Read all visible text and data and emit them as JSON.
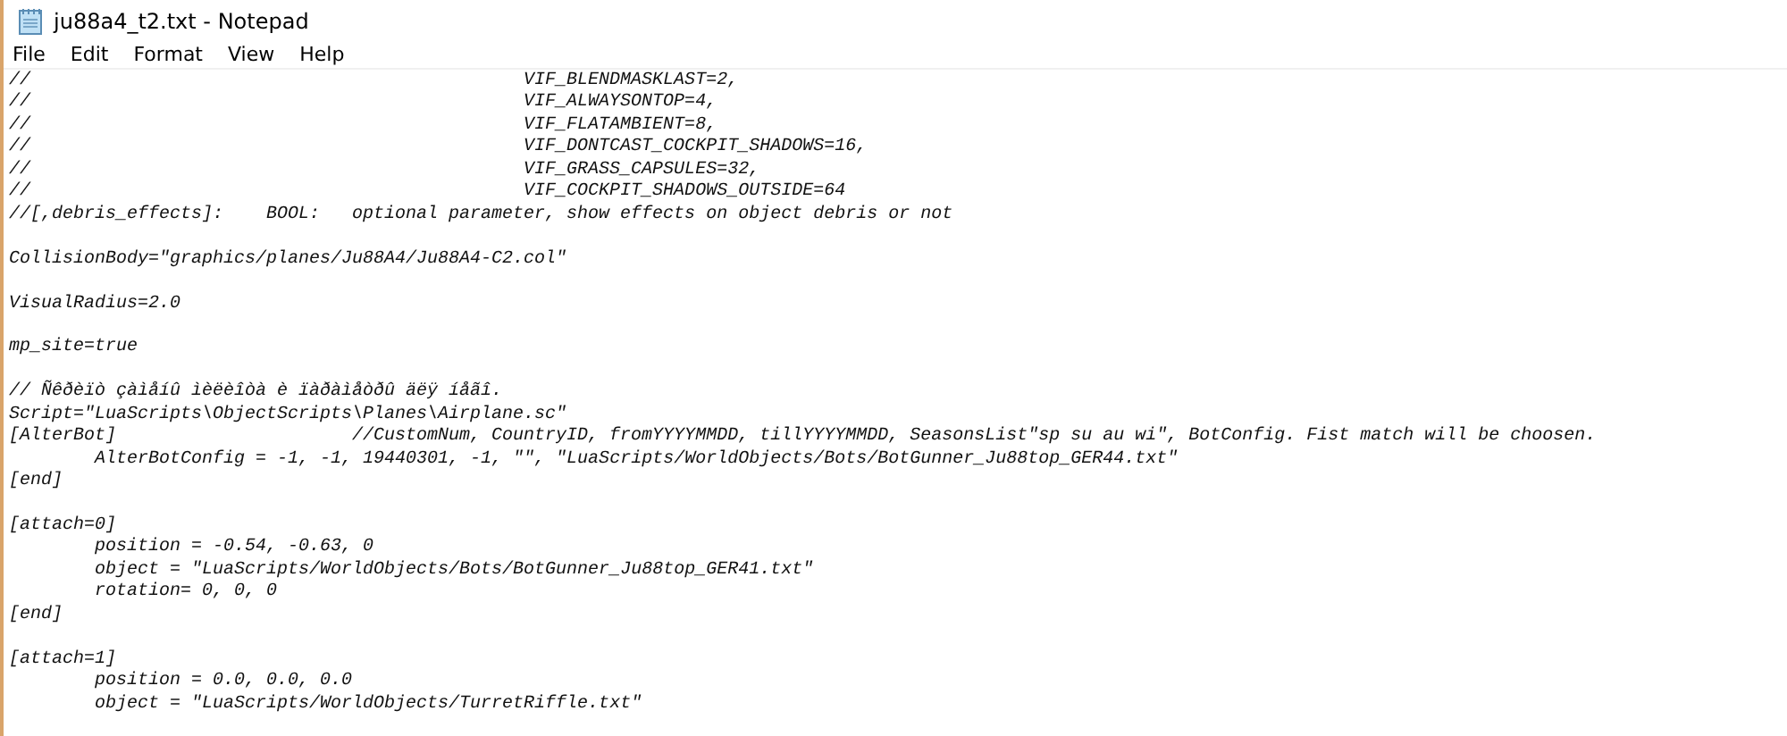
{
  "window": {
    "title": "ju88a4_t2.txt - Notepad"
  },
  "menu": [
    "File",
    "Edit",
    "Format",
    "View",
    "Help"
  ],
  "blocks": [
    [
      "//\t\t\t\t\t\tVIF_BLENDMASKLAST=2,",
      "//\t\t\t\t\t\tVIF_ALWAYSONTOP=4,",
      "//\t\t\t\t\t\tVIF_FLATAMBIENT=8,",
      "//\t\t\t\t\t\tVIF_DONTCAST_COCKPIT_SHADOWS=16,",
      "//\t\t\t\t\t\tVIF_GRASS_CAPSULES=32,",
      "//\t\t\t\t\t\tVIF_COCKPIT_SHADOWS_OUTSIDE=64",
      "//[,debris_effects]:\tBOOL:\toptional parameter, show effects on object debris or not"
    ],
    [
      "CollisionBody=\"graphics/planes/Ju88A4/Ju88A4-C2.col\""
    ],
    [
      "VisualRadius=2.0"
    ],
    [
      "mp_site=true"
    ],
    [
      "// Ñêðèïò çàìåíû ìèëèîòà è ïàðàìåòðû äëÿ íåãî.",
      "Script=\"LuaScripts\\ObjectScripts\\Planes\\Airplane.sc\"",
      "[AlterBot]\t\t\t//CustomNum, CountryID, fromYYYYMMDD, tillYYYYMMDD, SeasonsList\"sp su au wi\", BotConfig. Fist match will be choosen.",
      "\tAlterBotConfig = -1, -1, 19440301, -1, \"\", \"LuaScripts/WorldObjects/Bots/BotGunner_Ju88top_GER44.txt\"",
      "[end]"
    ],
    [
      "[attach=0]",
      "\tposition = -0.54, -0.63, 0",
      "\tobject = \"LuaScripts/WorldObjects/Bots/BotGunner_Ju88top_GER41.txt\"",
      "\trotation= 0, 0, 0",
      "[end]"
    ],
    [
      "[attach=1]",
      "\tposition = 0.0, 0.0, 0.0",
      "\tobject = \"LuaScripts/WorldObjects/TurretRiffle.txt\""
    ]
  ]
}
